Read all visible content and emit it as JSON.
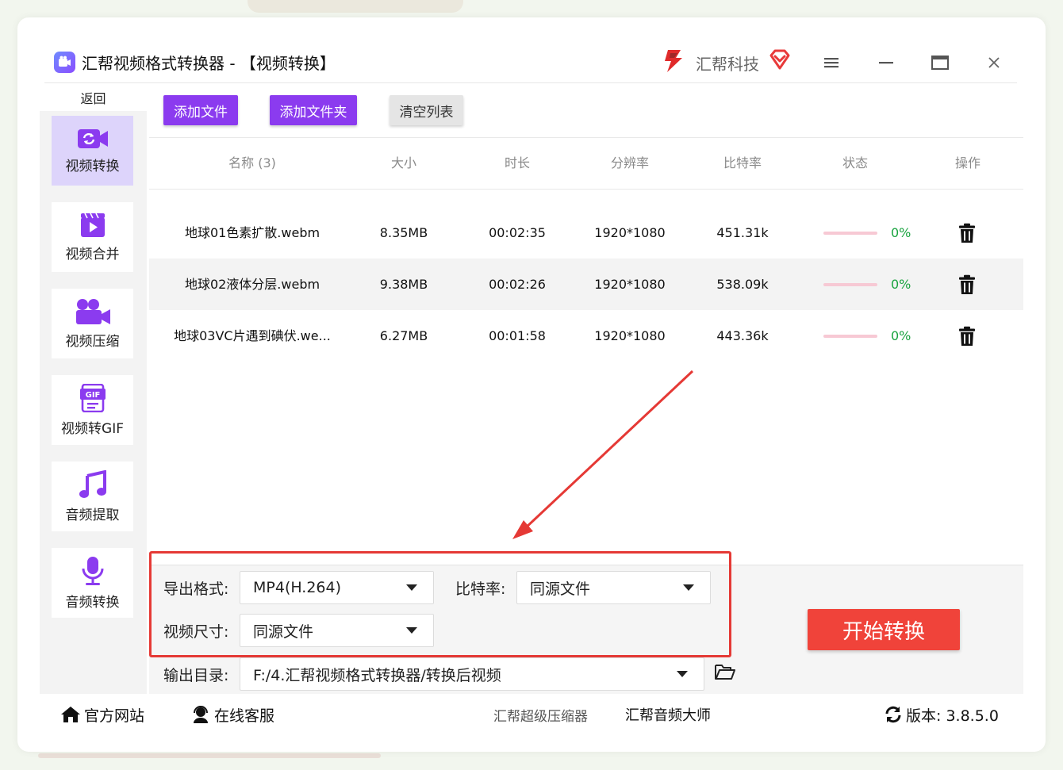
{
  "window": {
    "title": "汇帮视频格式转换器 - 【视频转换】",
    "brand_name": "汇帮科技",
    "icons": [
      "menu-icon",
      "minimize-icon",
      "maximize-icon",
      "close-icon"
    ]
  },
  "sidebar": {
    "back_label": "返回",
    "items": [
      {
        "label": "视频转换",
        "icon": "video-convert-icon",
        "active": true
      },
      {
        "label": "视频合并",
        "icon": "video-merge-icon",
        "active": false
      },
      {
        "label": "视频压缩",
        "icon": "video-compress-icon",
        "active": false
      },
      {
        "label": "视频转GIF",
        "icon": "gif-icon",
        "active": false
      },
      {
        "label": "音频提取",
        "icon": "music-note-icon",
        "active": false
      },
      {
        "label": "音频转换",
        "icon": "microphone-icon",
        "active": false
      }
    ]
  },
  "toolbar": {
    "add_file": "添加文件",
    "add_folder": "添加文件夹",
    "clear_list": "清空列表"
  },
  "table": {
    "headers": [
      "名称 (3)",
      "大小",
      "时长",
      "分辨率",
      "比特率",
      "状态",
      "操作"
    ],
    "rows": [
      {
        "name": "地球01色素扩散.webm",
        "size": "8.35MB",
        "duration": "00:02:35",
        "resolution": "1920*1080",
        "bitrate": "451.31k",
        "progress": "0%",
        "progress_value": 0
      },
      {
        "name": "地球02液体分层.webm",
        "size": "9.38MB",
        "duration": "00:02:26",
        "resolution": "1920*1080",
        "bitrate": "538.09k",
        "progress": "0%",
        "progress_value": 0
      },
      {
        "name": "地球03VC片遇到碘伏.we...",
        "size": "6.27MB",
        "duration": "00:01:58",
        "resolution": "1920*1080",
        "bitrate": "443.36k",
        "progress": "0%",
        "progress_value": 0
      }
    ]
  },
  "settings": {
    "format_label": "导出格式:",
    "format_value": "MP4(H.264)",
    "bitrate_label": "比特率:",
    "bitrate_value": "同源文件",
    "size_label": "视频尺寸:",
    "size_value": "同源文件",
    "output_label": "输出目录:",
    "output_value": "F:/4.汇帮视频格式转换器/转换后视频",
    "start_button": "开始转换"
  },
  "statusbar": {
    "website": "官方网站",
    "support": "在线客服",
    "link1": "汇帮超级压缩器",
    "link2": "汇帮音频大师",
    "version": "版本: 3.8.5.0"
  },
  "colors": {
    "accent_purple": "#8b3bef",
    "start_red": "#f0433a",
    "frame_red": "#e53935",
    "progress_pink": "#f7c9d4",
    "percent_green": "#19a33f"
  }
}
